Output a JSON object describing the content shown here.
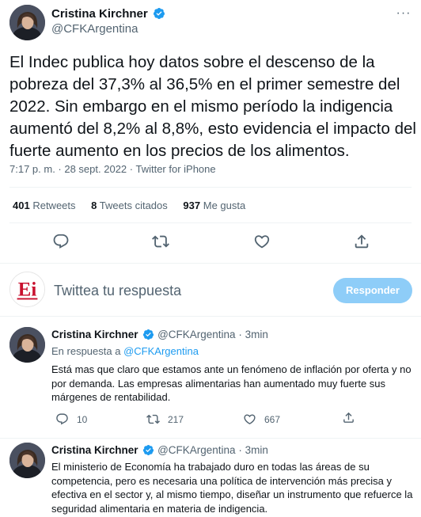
{
  "main_tweet": {
    "author_name": "Cristina Kirchner",
    "author_handle": "@CFKArgentina",
    "more_label": "···",
    "text": "El Indec publica hoy datos sobre el descenso de la pobreza del 37,3% al 36,5% en el primer semestre del 2022. Sin embargo en el mismo período la indigencia aumentó del 8,2% al 8,8%, esto evidencia el impacto del fuerte aumento en los precios de los alimentos.",
    "meta": "7:17 p. m. · 28 sept. 2022 · Twitter for iPhone",
    "stats": {
      "retweets_count": "401",
      "retweets_label": "Retweets",
      "quotes_count": "8",
      "quotes_label": "Tweets citados",
      "likes_count": "937",
      "likes_label": "Me gusta"
    },
    "actions": [
      "reply-icon",
      "retweet-icon",
      "like-icon",
      "share-icon"
    ]
  },
  "composer": {
    "avatar_label": "Ei",
    "placeholder": "Twittea tu respuesta",
    "reply_button": "Responder"
  },
  "replies": [
    {
      "author_name": "Cristina Kirchner",
      "author_handle": "@CFKArgentina",
      "separator": "·",
      "time": "3min",
      "reply_to_prefix": "En respuesta a",
      "reply_to_handle": "@CFKArgentina",
      "text": "Está mas que claro que estamos ante un fenómeno de inflación por oferta y no por demanda. Las empresas alimentarias han aumentado muy fuerte sus márgenes de rentabilidad.",
      "replies_count": "10",
      "retweets_count": "217",
      "likes_count": "667"
    },
    {
      "author_name": "Cristina Kirchner",
      "author_handle": "@CFKArgentina",
      "separator": "·",
      "time": "3min",
      "text": "El ministerio de Economía ha trabajado duro en todas las áreas de su competencia, pero es necesaria una política de intervención más precisa y efectiva en el sector y, al mismo tiempo, diseñar un instrumento que refuerce la seguridad alimentaria en materia de indigencia."
    }
  ],
  "colors": {
    "accent": "#1d9bf0",
    "reply_button_bg": "#8ecdf8",
    "text_primary": "#0f1419",
    "text_secondary": "#536471",
    "divider": "#eff3f4"
  }
}
